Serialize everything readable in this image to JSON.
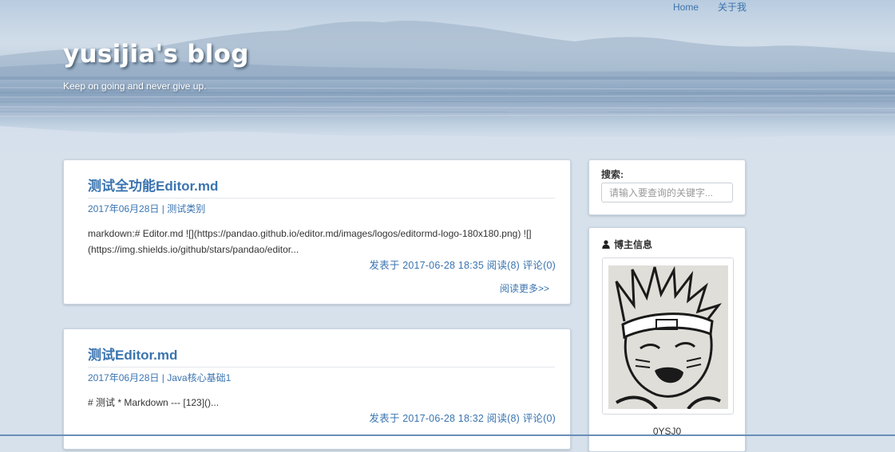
{
  "nav": {
    "home": "Home",
    "about": "关于我"
  },
  "header": {
    "title": "yusijia's blog",
    "subtitle": "Keep on going and never give up."
  },
  "posts": [
    {
      "title": "测试全功能Editor.md",
      "date": "2017年06月28日",
      "separator": "|",
      "category": "测试类别",
      "excerpt": "markdown:#  Editor.md  ![](https://pandao.github.io/editor.md/images/logos/editormd-logo-180x180.png)  ![](https://img.shields.io/github/stars/pandao/editor...",
      "footer": "发表于 2017-06-28 18:35 阅读(8) 评论(0)",
      "read_more": "阅读更多>>"
    },
    {
      "title": "测试Editor.md",
      "date": "2017年06月28日",
      "separator": "|",
      "category": "Java核心基础1",
      "excerpt": "# 测试 * Markdown --- [123]()...",
      "footer": "发表于 2017-06-28 18:32 阅读(8) 评论(0)"
    }
  ],
  "sidebar": {
    "search": {
      "title": "搜索:",
      "placeholder": "请输入要查询的关键字..."
    },
    "profile": {
      "title": "博主信息",
      "icon": "user-icon",
      "username": "0YSJ0"
    }
  },
  "colors": {
    "accent": "#3a74b0",
    "background": "#d6e1ec"
  }
}
